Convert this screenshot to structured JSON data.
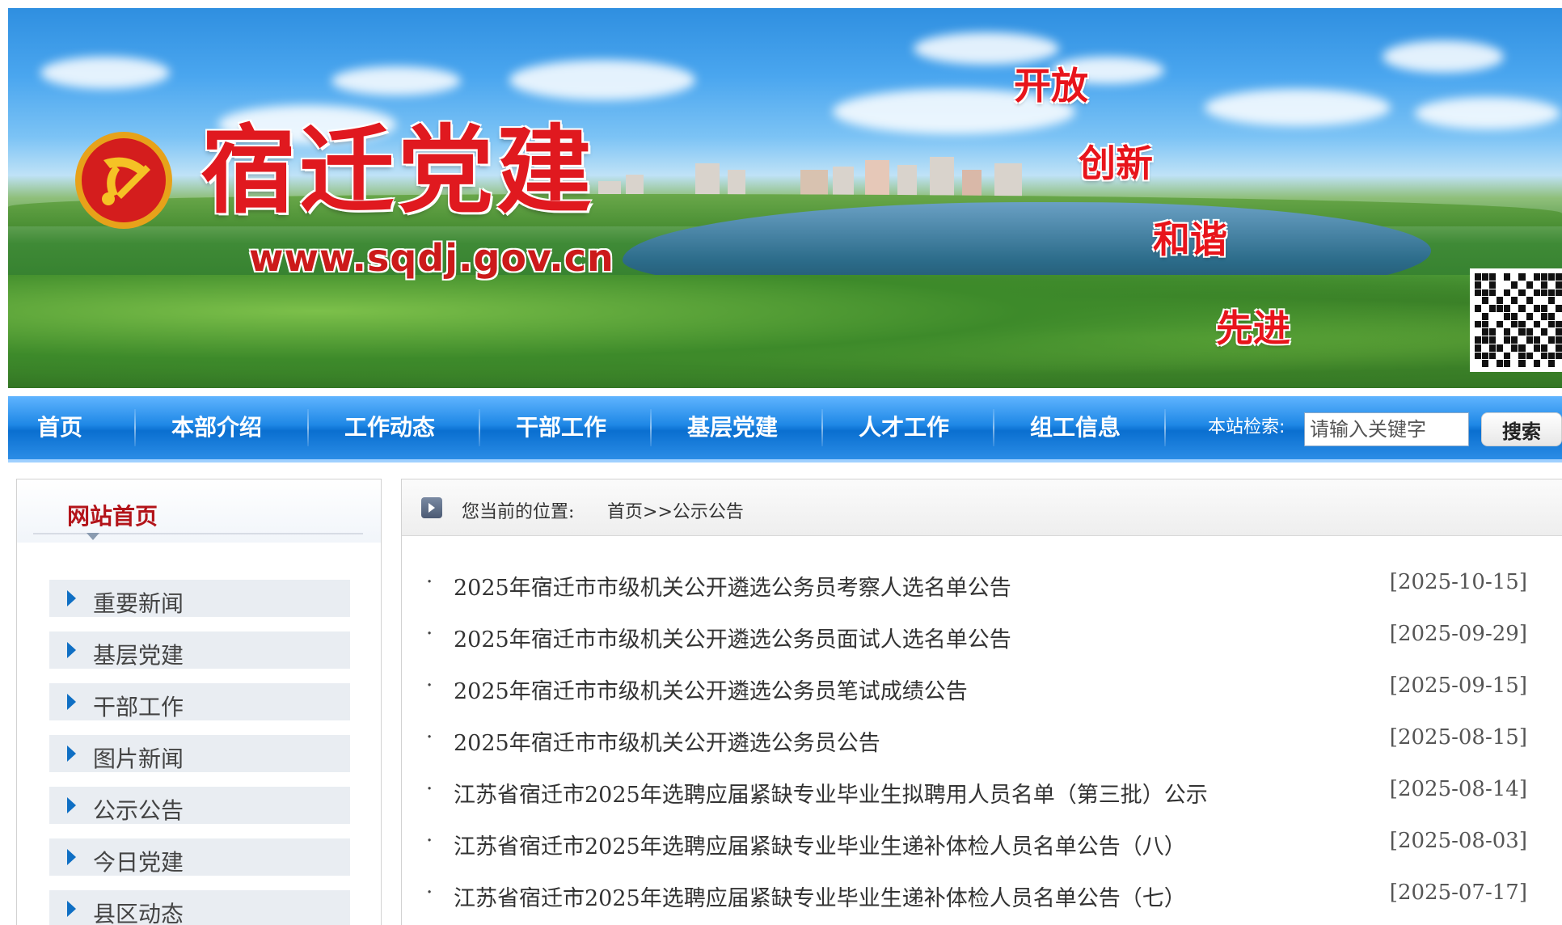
{
  "banner": {
    "title": "宿迁党建",
    "url": "www.sqdj.gov.cn",
    "slogans": [
      "开放",
      "创新",
      "和谐",
      "先进"
    ]
  },
  "nav": {
    "items": [
      "首页",
      "本部介绍",
      "工作动态",
      "干部工作",
      "基层党建",
      "人才工作",
      "组工信息"
    ],
    "search_label": "本站检索:",
    "search_placeholder": "请输入关键字",
    "search_button": "搜索"
  },
  "sidebar": {
    "title": "网站首页",
    "items": [
      "重要新闻",
      "基层党建",
      "干部工作",
      "图片新闻",
      "公示公告",
      "今日党建",
      "县区动态"
    ]
  },
  "breadcrumb": {
    "prefix": "您当前的位置:",
    "home": "首页",
    "separator": ">>",
    "current": "公示公告"
  },
  "news": [
    {
      "bullet": "·",
      "title": "2025年宿迁市市级机关公开遴选公务员考察人选名单公告",
      "date": "[2025-10-15]"
    },
    {
      "bullet": "·",
      "title": "2025年宿迁市市级机关公开遴选公务员面试人选名单公告",
      "date": "[2025-09-29]"
    },
    {
      "bullet": "·",
      "title": "2025年宿迁市市级机关公开遴选公务员笔试成绩公告",
      "date": "[2025-09-15]"
    },
    {
      "bullet": "·",
      "title": "2025年宿迁市市级机关公开遴选公务员公告",
      "date": "[2025-08-15]"
    },
    {
      "bullet": "·",
      "title": "江苏省宿迁市2025年选聘应届紧缺专业毕业生拟聘用人员名单（第三批）公示",
      "date": "[2025-08-14]"
    },
    {
      "bullet": "·",
      "title": "江苏省宿迁市2025年选聘应届紧缺专业毕业生递补体检人员名单公告（八）",
      "date": "[2025-08-03]"
    },
    {
      "bullet": "·",
      "title": "江苏省宿迁市2025年选聘应届紧缺专业毕业生递补体检人员名单公告（七）",
      "date": "[2025-07-17]"
    }
  ],
  "colors": {
    "nav_blue": "#1f88e6",
    "brand_red": "#e0191f",
    "sidebar_title_red": "#b3141a",
    "arrow_blue": "#0f6fc4"
  },
  "icons": {
    "emblem": "party-emblem-icon",
    "qr": "qr-code-icon",
    "crumb": "breadcrumb-arrow-icon",
    "side_arrow": "triangle-right-icon"
  }
}
